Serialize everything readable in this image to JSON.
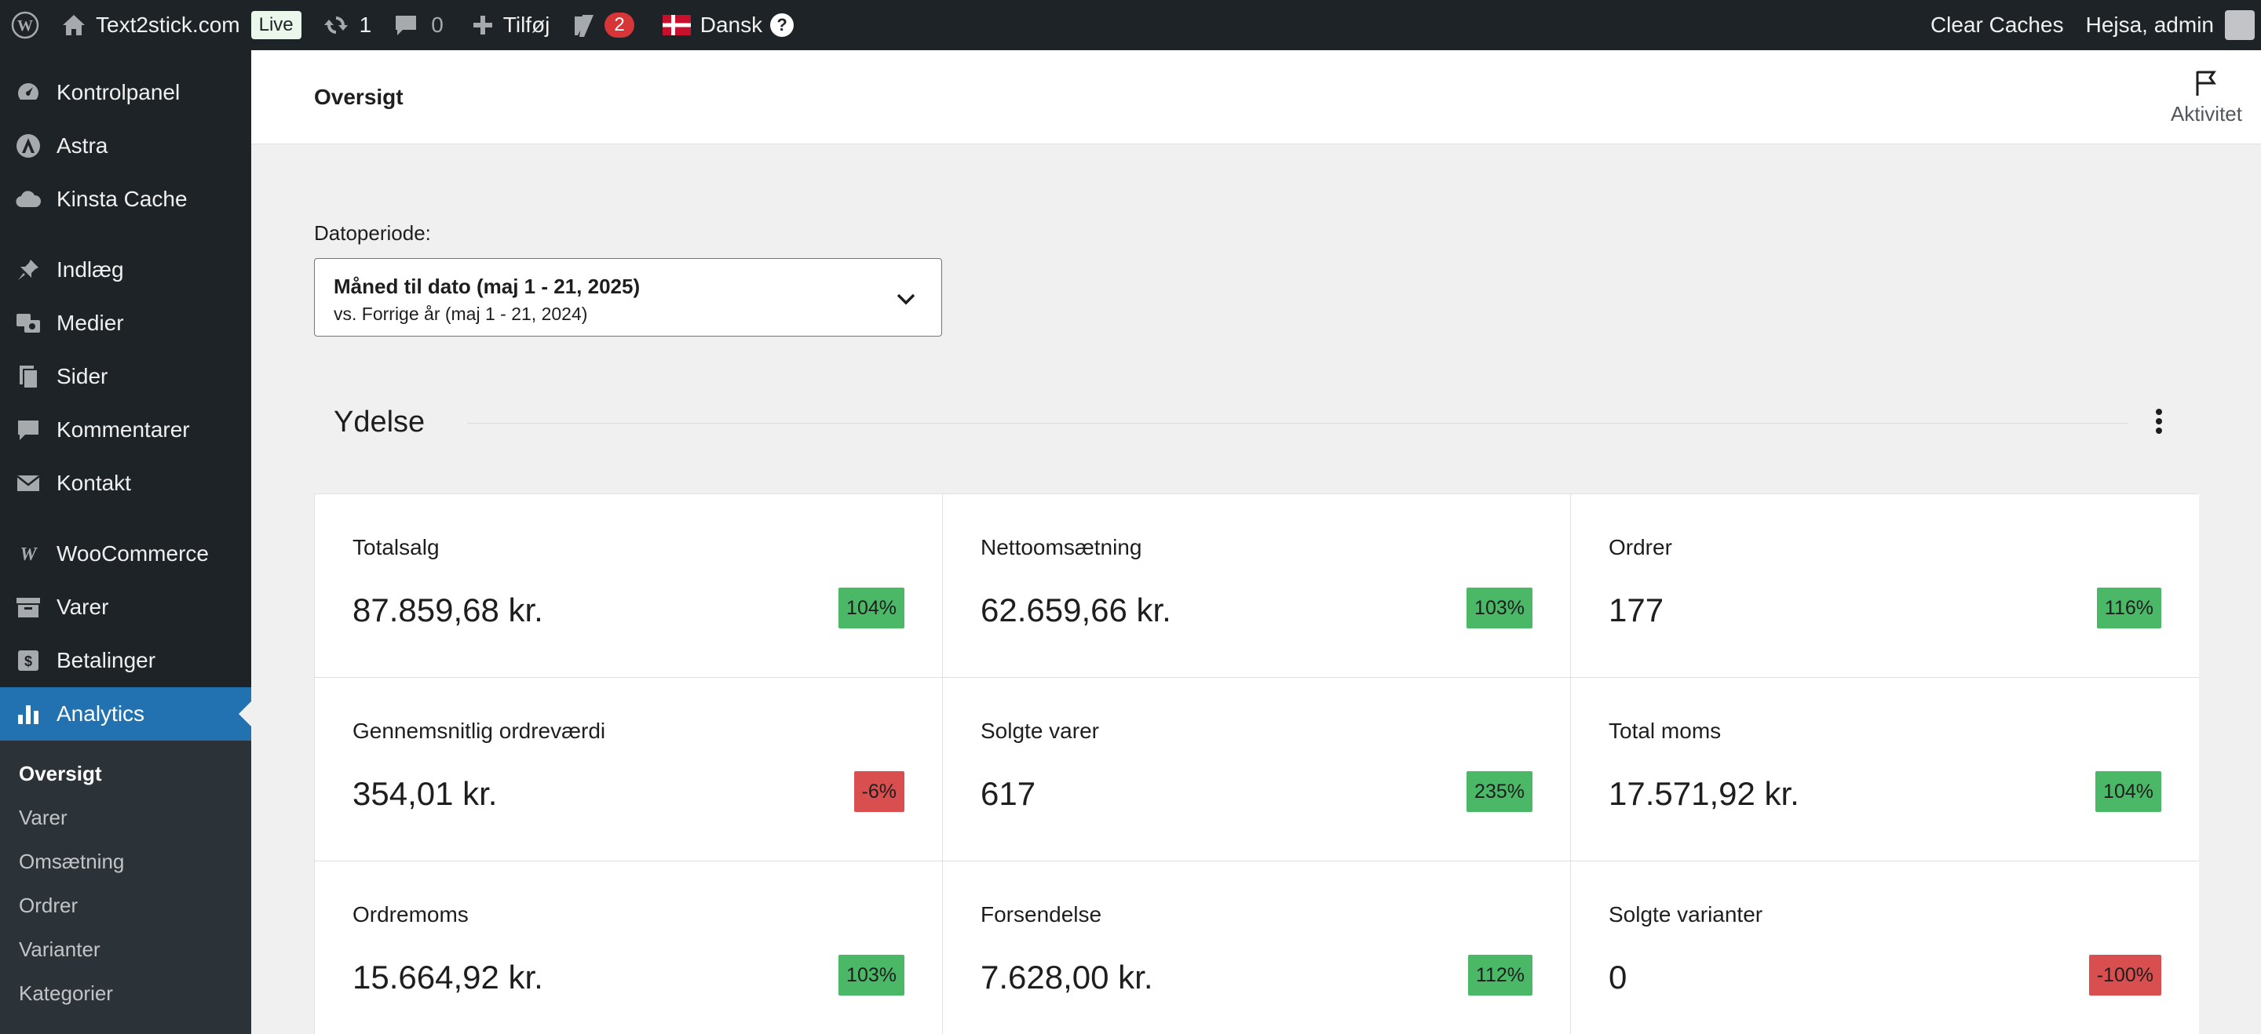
{
  "adminbar": {
    "site_name": "Text2stick.com",
    "live_badge": "Live",
    "updates_count": "1",
    "comments_count": "0",
    "new_label": "Tilføj",
    "seo_count": "2",
    "language_label": "Dansk",
    "help_label": "?",
    "clear_caches": "Clear Caches",
    "greeting": "Hejsa, admin"
  },
  "sidebar": {
    "items": [
      {
        "label": "Kontrolpanel",
        "icon": "dashboard-icon"
      },
      {
        "label": "Astra",
        "icon": "astra-icon"
      },
      {
        "label": "Kinsta Cache",
        "icon": "cloud-icon"
      },
      {
        "label": "Indlæg",
        "icon": "pin-icon"
      },
      {
        "label": "Medier",
        "icon": "media-icon"
      },
      {
        "label": "Sider",
        "icon": "pages-icon"
      },
      {
        "label": "Kommentarer",
        "icon": "comment-icon"
      },
      {
        "label": "Kontakt",
        "icon": "mail-icon"
      },
      {
        "label": "WooCommerce",
        "icon": "woo-icon"
      },
      {
        "label": "Varer",
        "icon": "archive-icon"
      },
      {
        "label": "Betalinger",
        "icon": "payments-icon"
      },
      {
        "label": "Analytics",
        "icon": "chart-bar-icon"
      }
    ],
    "submenu": [
      "Oversigt",
      "Varer",
      "Omsætning",
      "Ordrer",
      "Varianter",
      "Kategorier"
    ]
  },
  "header": {
    "title": "Oversigt",
    "activity": "Aktivitet"
  },
  "date_filter": {
    "label": "Datoperiode:",
    "value": "Måned til dato (maj 1 - 21, 2025)",
    "compare": "vs. Forrige år (maj 1 - 21, 2024)"
  },
  "performance": {
    "title": "Ydelse",
    "cards": [
      {
        "label": "Totalsalg",
        "value": "87.859,68 kr.",
        "delta": "104%",
        "trend": "up"
      },
      {
        "label": "Nettoomsætning",
        "value": "62.659,66 kr.",
        "delta": "103%",
        "trend": "up"
      },
      {
        "label": "Ordrer",
        "value": "177",
        "delta": "116%",
        "trend": "up"
      },
      {
        "label": "Gennemsnitlig ordreværdi",
        "value": "354,01 kr.",
        "delta": "-6%",
        "trend": "down"
      },
      {
        "label": "Solgte varer",
        "value": "617",
        "delta": "235%",
        "trend": "up"
      },
      {
        "label": "Total moms",
        "value": "17.571,92 kr.",
        "delta": "104%",
        "trend": "up"
      },
      {
        "label": "Ordremoms",
        "value": "15.664,92 kr.",
        "delta": "103%",
        "trend": "up"
      },
      {
        "label": "Forsendelse",
        "value": "7.628,00 kr.",
        "delta": "112%",
        "trend": "up"
      },
      {
        "label": "Solgte varianter",
        "value": "0",
        "delta": "-100%",
        "trend": "down"
      }
    ]
  },
  "colors": {
    "adminbar_bg": "#1d2327",
    "accent": "#2271b1",
    "delta_up": "#4ab866",
    "delta_down": "#d94f4f"
  }
}
